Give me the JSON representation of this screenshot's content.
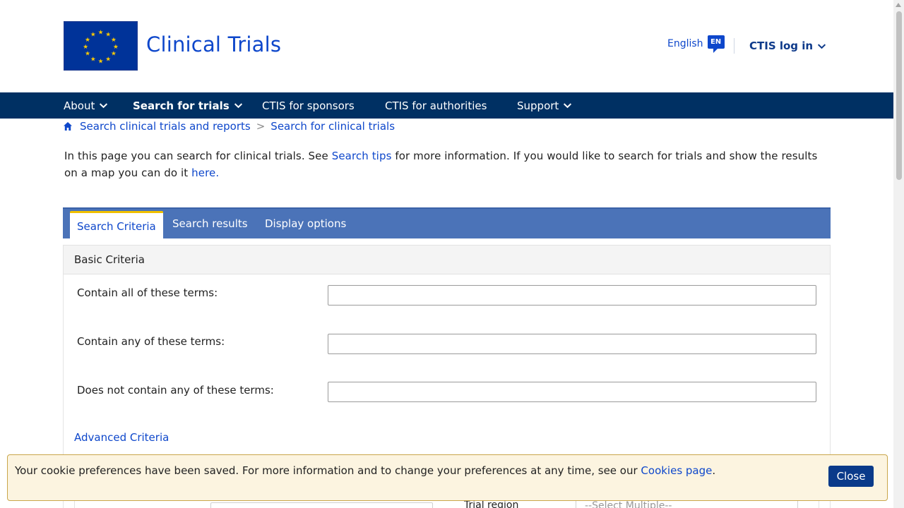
{
  "header": {
    "site_title": "Clinical Trials",
    "language_label": "English",
    "language_code": "EN",
    "login_label": "CTIS log in"
  },
  "nav": {
    "items": [
      {
        "label": "About",
        "has_dropdown": true
      },
      {
        "label": "Search for trials",
        "has_dropdown": true,
        "active": true
      },
      {
        "label": "CTIS for sponsors",
        "has_dropdown": false
      },
      {
        "label": "CTIS for authorities",
        "has_dropdown": false
      },
      {
        "label": "Support",
        "has_dropdown": true
      }
    ]
  },
  "breadcrumb": {
    "items": [
      "Search clinical trials and reports",
      "Search for clinical trials"
    ],
    "separator": ">"
  },
  "intro": {
    "text_1": "In this page you can search for clinical trials. See ",
    "link_1": "Search tips",
    "text_2": " for more information. If you would like to search for trials and show the results on a map you can do it ",
    "link_2": "here."
  },
  "tabs": {
    "items": [
      "Search Criteria",
      "Search results",
      "Display options"
    ],
    "active": "Search Criteria"
  },
  "basic_criteria": {
    "heading": "Basic Criteria",
    "fields": [
      {
        "label": "Contain all of these terms:",
        "value": ""
      },
      {
        "label": "Contain any of these terms:",
        "value": ""
      },
      {
        "label": "Does not contain any of these terms:",
        "value": ""
      }
    ]
  },
  "advanced_criteria": {
    "link": "Advanced Criteria",
    "trial_region_label": "Trial region",
    "trial_region_placeholder": "--Select Multiple--"
  },
  "cookie_bar": {
    "text": "Your cookie preferences have been saved. For more information and to change your preferences at any time, see our ",
    "link": "Cookies page",
    "suffix": ".",
    "close_label": "Close"
  },
  "colors": {
    "brand_blue": "#0e47cb",
    "nav_bg": "#003063",
    "tab_bar_bg": "#4b73b8",
    "eu_flag_blue": "#003399",
    "eu_star_yellow": "#ffcc00",
    "cookie_bg": "#fcf4e0",
    "close_button_bg": "#0a3a8a"
  }
}
